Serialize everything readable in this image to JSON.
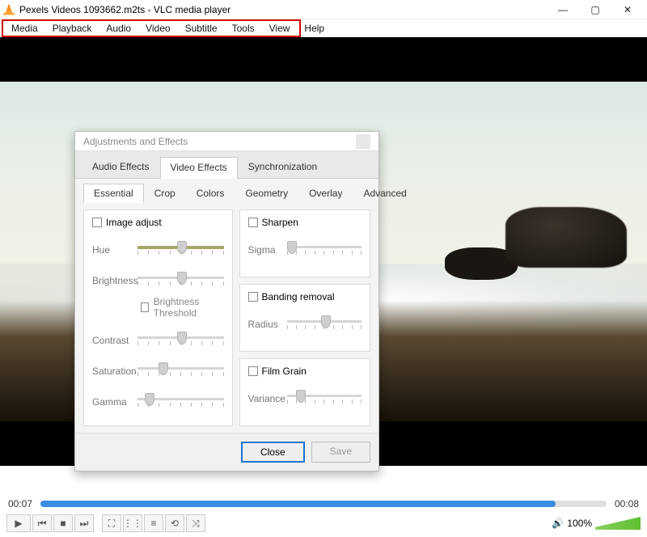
{
  "titlebar": {
    "title": "Pexels Videos 1093662.m2ts - VLC media player"
  },
  "menu": {
    "items": [
      "Media",
      "Playback",
      "Audio",
      "Video",
      "Subtitle",
      "Tools",
      "View",
      "Help"
    ]
  },
  "dialog": {
    "title": "Adjustments and Effects",
    "tabs": [
      "Audio Effects",
      "Video Effects",
      "Synchronization"
    ],
    "active_tab": 1,
    "subtabs": [
      "Essential",
      "Crop",
      "Colors",
      "Geometry",
      "Overlay",
      "Advanced"
    ],
    "active_subtab": 0,
    "left": {
      "header": "Image adjust",
      "rows": {
        "hue": "Hue",
        "brightness": "Brightness",
        "threshold": "Brightness Threshold",
        "contrast": "Contrast",
        "saturation": "Saturation",
        "gamma": "Gamma"
      }
    },
    "right": {
      "sharpen": {
        "header": "Sharpen",
        "label": "Sigma"
      },
      "banding": {
        "header": "Banding removal",
        "label": "Radius"
      },
      "grain": {
        "header": "Film Grain",
        "label": "Variance"
      }
    },
    "buttons": {
      "close": "Close",
      "save": "Save"
    }
  },
  "player": {
    "time_current": "00:07",
    "time_total": "00:08",
    "volume_pct": "100%"
  }
}
